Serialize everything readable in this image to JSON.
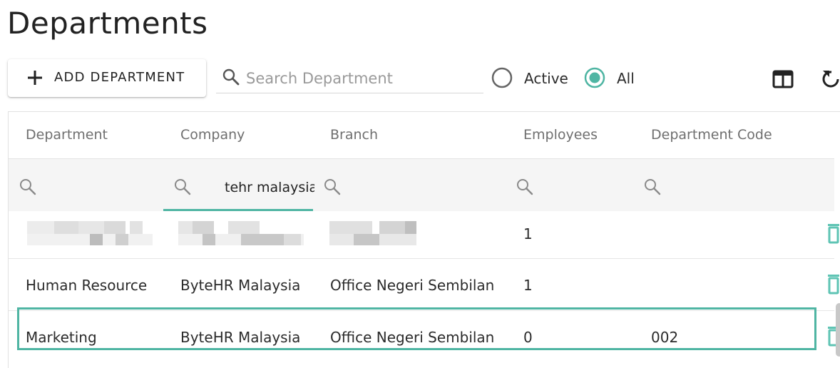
{
  "page": {
    "title": "Departments"
  },
  "toolbar": {
    "add_label": "ADD DEPARTMENT",
    "search_placeholder": "Search Department",
    "search_value": "",
    "radio_active_label": "Active",
    "radio_all_label": "All",
    "selected_filter": "All",
    "icons": [
      "plus-icon",
      "search-icon",
      "columns-icon",
      "refresh-icon"
    ]
  },
  "colors": {
    "accent": "#4fb5a3",
    "delete": "#5fc4b4"
  },
  "table": {
    "columns": [
      "Department",
      "Company",
      "Branch",
      "Employees",
      "Department Code"
    ],
    "filters": [
      "",
      "tehr malaysia",
      "",
      "",
      ""
    ],
    "rows": [
      {
        "department": "",
        "company": "",
        "branch": "",
        "employees": "1",
        "code": "",
        "redacted": true
      },
      {
        "department": "Human Resource",
        "company": "ByteHR Malaysia",
        "branch": "Office Negeri Sembilan",
        "employees": "1",
        "code": ""
      },
      {
        "department": "Marketing",
        "company": "ByteHR Malaysia",
        "branch": "Office Negeri Sembilan",
        "employees": "0",
        "code": "002",
        "highlighted": true
      }
    ]
  }
}
